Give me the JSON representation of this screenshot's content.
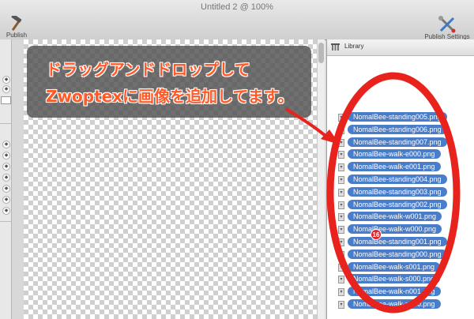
{
  "window": {
    "title": "Untitled 2 @ 100%"
  },
  "toolbar": {
    "publish_label": "Publish",
    "publish_icon": "hammer-icon",
    "publish_settings_label": "Publish Settings",
    "publish_settings_icon": "tools-icon"
  },
  "library": {
    "title": "Library"
  },
  "callout": {
    "line1": "ドラッグアンドドロップして",
    "line2": "Zwoptexに画像を追加してます。"
  },
  "files": [
    {
      "name": "NomalBee-standing005.png"
    },
    {
      "name": "NomalBee-standing006.png"
    },
    {
      "name": "NomalBee-standing007.png"
    },
    {
      "name": "NomalBee-walk-e000.png"
    },
    {
      "name": "NomalBee-walk-e001.png"
    },
    {
      "name": "NomalBee-standing004.png"
    },
    {
      "name": "NomalBee-standing003.png"
    },
    {
      "name": "NomalBee-standing002.png"
    },
    {
      "name": "NomalBee-walk-w001.png"
    },
    {
      "name": "NomalBee-walk-w000.png"
    },
    {
      "name": "NomalBee-standing001.png"
    },
    {
      "name": "NomalBee-standing000.png"
    },
    {
      "name": "NomalBee-walk-s001.png"
    },
    {
      "name": "NomalBee-walk-s000.png"
    },
    {
      "name": "NomalBee-walk-n001.png"
    },
    {
      "name": "NomalBee-walk-n000.png"
    }
  ],
  "drag_badge": "16",
  "colors": {
    "selection": "#4a7dc9",
    "annotation": "#e8221c",
    "callout_text": "#ff5a28"
  }
}
